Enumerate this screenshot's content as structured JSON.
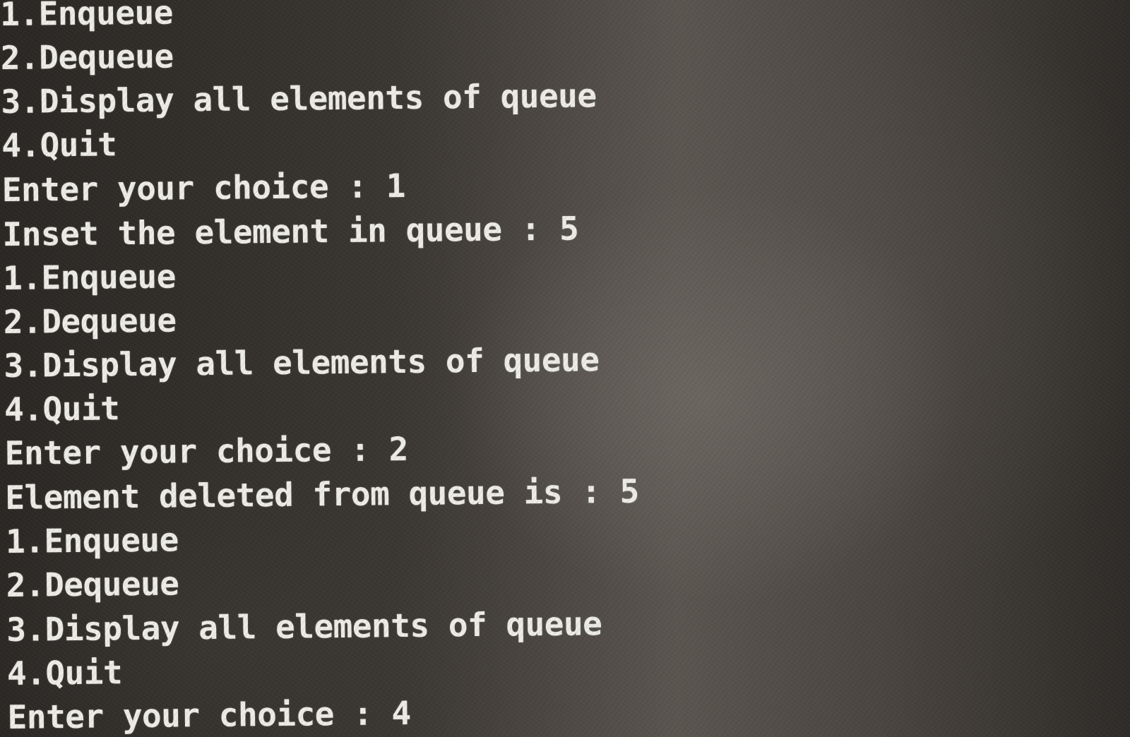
{
  "terminal": {
    "lines": [
      "1.Enqueue",
      "2.Dequeue",
      "3.Display all elements of queue",
      "4.Quit",
      "Enter your choice : 1",
      "Inset the element in queue : 5",
      "1.Enqueue",
      "2.Dequeue",
      "3.Display all elements of queue",
      "4.Quit",
      "Enter your choice : 2",
      "Element deleted from queue is : 5",
      "1.Enqueue",
      "2.Dequeue",
      "3.Display all elements of queue",
      "4.Quit",
      "Enter your choice : 4"
    ]
  }
}
